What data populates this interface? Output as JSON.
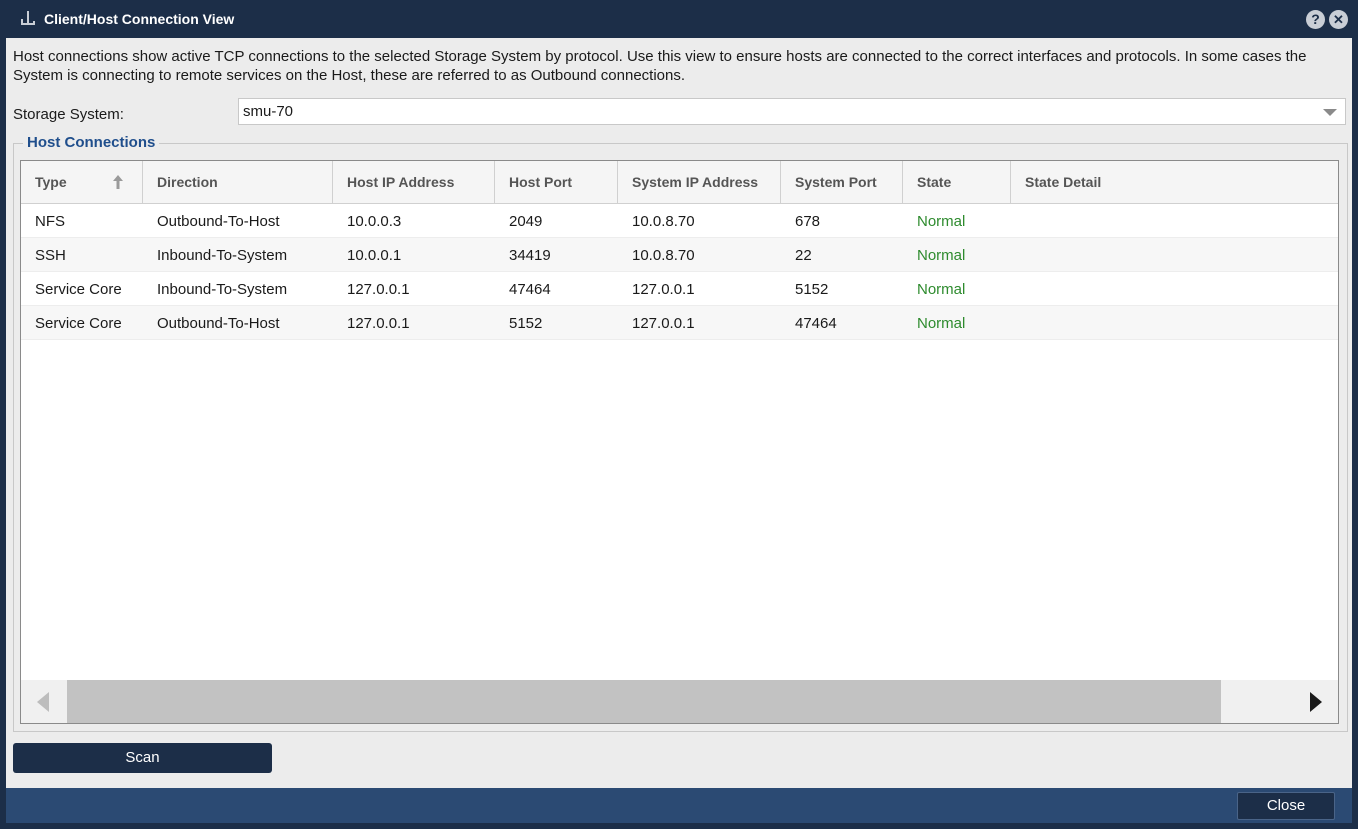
{
  "window": {
    "title": "Client/Host Connection View",
    "help_glyph": "?",
    "close_glyph": "✕"
  },
  "description": "Host connections show active TCP connections to the selected Storage System by protocol. Use this view to ensure hosts are connected to the correct interfaces and protocols. In some cases the System is connecting to remote services on the Host, these are referred to as Outbound connections.",
  "storage_system": {
    "label": "Storage System:",
    "value": "smu-70"
  },
  "host_connections": {
    "legend": "Host Connections",
    "columns": [
      "Type",
      "Direction",
      "Host IP Address",
      "Host Port",
      "System IP Address",
      "System Port",
      "State",
      "State Detail"
    ],
    "rows": [
      [
        "NFS",
        "Outbound-To-Host",
        "10.0.0.3",
        "2049",
        "10.0.8.70",
        "678",
        "Normal",
        ""
      ],
      [
        "SSH",
        "Inbound-To-System",
        "10.0.0.1",
        "34419",
        "10.0.8.70",
        "22",
        "Normal",
        ""
      ],
      [
        "Service Core",
        "Inbound-To-System",
        "127.0.0.1",
        "47464",
        "127.0.0.1",
        "5152",
        "Normal",
        ""
      ],
      [
        "Service Core",
        "Outbound-To-Host",
        "127.0.0.1",
        "5152",
        "127.0.0.1",
        "47464",
        "Normal",
        ""
      ]
    ]
  },
  "buttons": {
    "scan": "Scan",
    "close": "Close"
  },
  "colors": {
    "titlebar": "#1c2e48",
    "footer": "#2b4a73",
    "legend": "#1f4e8c",
    "state_normal": "#2e8b2e"
  }
}
